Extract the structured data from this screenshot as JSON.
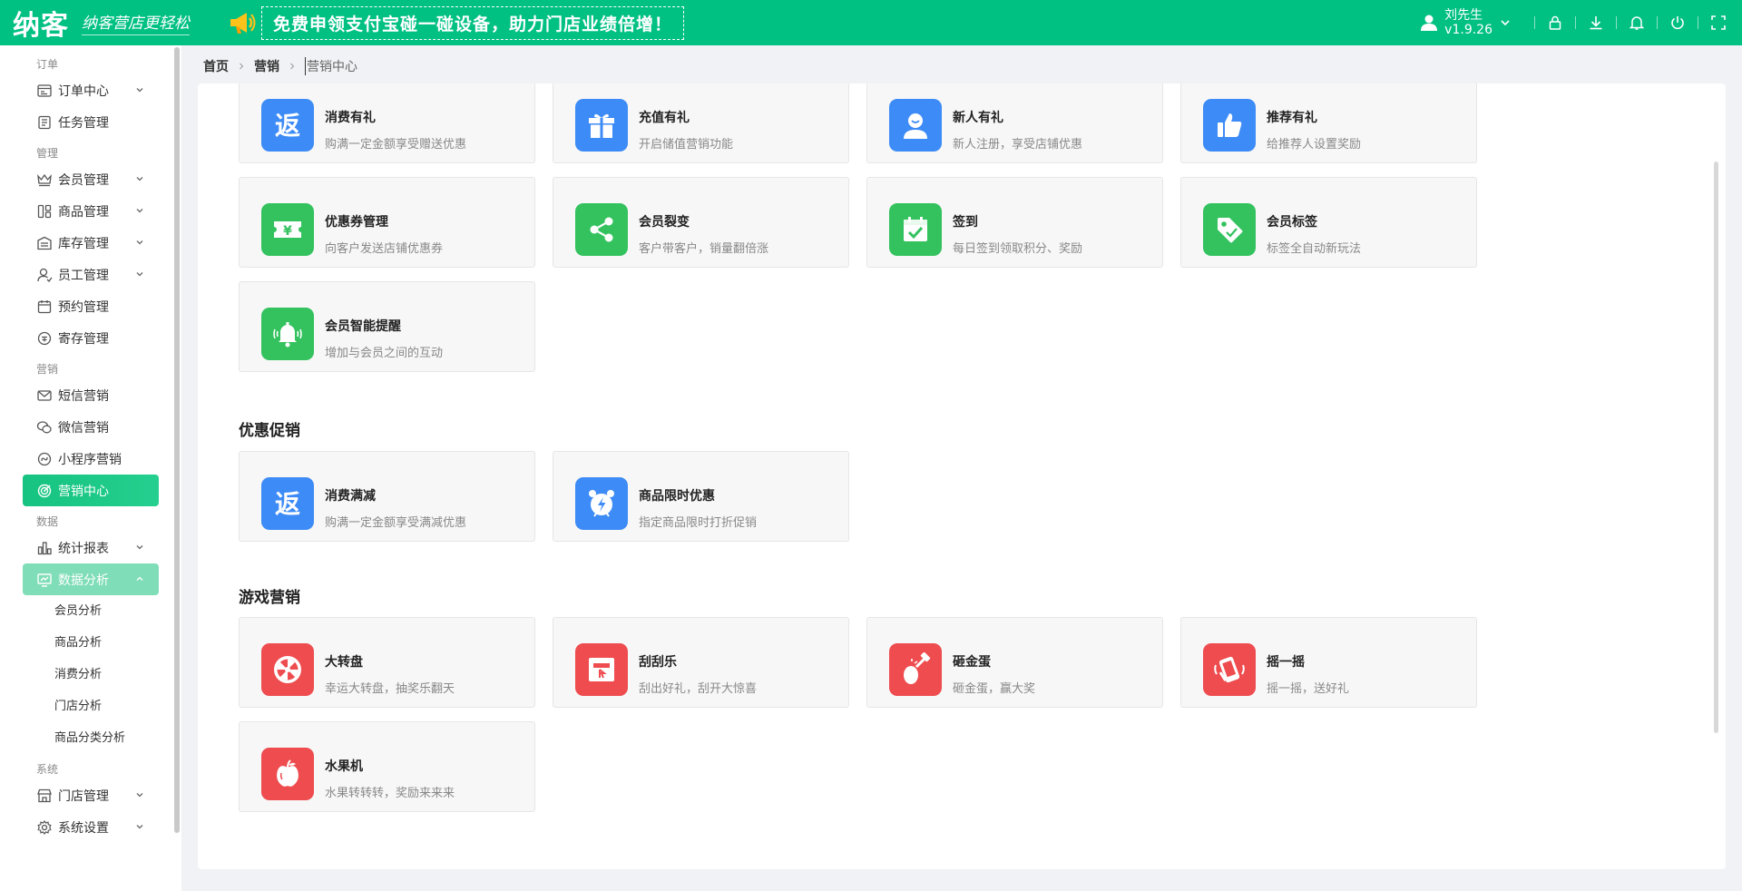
{
  "header": {
    "logo": "纳客",
    "slogan": "纳客营店更轻松",
    "promo_text": "免费申领支付宝碰一碰设备，助力门店业绩倍增！",
    "user_name": "刘先生",
    "version": "v1.9.26"
  },
  "sidebar": {
    "groups": {
      "order": "订单",
      "manage": "管理",
      "marketing": "营销",
      "data": "数据",
      "system": "系统"
    },
    "items": {
      "order_center": "订单中心",
      "task_manage": "任务管理",
      "member_manage": "会员管理",
      "goods_manage": "商品管理",
      "stock_manage": "库存管理",
      "staff_manage": "员工管理",
      "booking_manage": "预约管理",
      "deposit_manage": "寄存管理",
      "sms_marketing": "短信营销",
      "wechat_marketing": "微信营销",
      "miniapp_marketing": "小程序营销",
      "marketing_center": "营销中心",
      "stats_report": "统计报表",
      "data_analysis": "数据分析",
      "store_manage": "门店管理",
      "system_settings": "系统设置"
    },
    "sub_items": {
      "member_analysis": "会员分析",
      "goods_analysis": "商品分析",
      "consume_analysis": "消费分析",
      "store_analysis": "门店分析",
      "category_analysis": "商品分类分析"
    }
  },
  "breadcrumb": {
    "home": "首页",
    "marketing": "营销",
    "current": "营销中心"
  },
  "sections": {
    "discount": "优惠促销",
    "game": "游戏营销"
  },
  "cards": {
    "consume_gift": {
      "title": "消费有礼",
      "desc": "购满一定金额享受赠送优惠"
    },
    "recharge_gift": {
      "title": "充值有礼",
      "desc": "开启储值营销功能"
    },
    "newbie_gift": {
      "title": "新人有礼",
      "desc": "新人注册，享受店铺优惠"
    },
    "referral_gift": {
      "title": "推荐有礼",
      "desc": "给推荐人设置奖励"
    },
    "coupon_manage": {
      "title": "优惠券管理",
      "desc": "向客户发送店铺优惠券"
    },
    "member_fission": {
      "title": "会员裂变",
      "desc": "客户带客户，销量翻倍涨"
    },
    "checkin": {
      "title": "签到",
      "desc": "每日签到领取积分、奖励"
    },
    "member_tag": {
      "title": "会员标签",
      "desc": "标签全自动新玩法"
    },
    "smart_remind": {
      "title": "会员智能提醒",
      "desc": "增加与会员之间的互动"
    },
    "full_reduction": {
      "title": "消费满减",
      "desc": "购满一定金额享受满减优惠"
    },
    "flash_discount": {
      "title": "商品限时优惠",
      "desc": "指定商品限时打折促销"
    },
    "wheel": {
      "title": "大转盘",
      "desc": "幸运大转盘，抽奖乐翻天"
    },
    "scratch": {
      "title": "刮刮乐",
      "desc": "刮出好礼，刮开大惊喜"
    },
    "golden_egg": {
      "title": "砸金蛋",
      "desc": "砸金蛋，赢大奖"
    },
    "shake": {
      "title": "摇一摇",
      "desc": "摇一摇，送好礼"
    },
    "fruit_machine": {
      "title": "水果机",
      "desc": "水果转转转，奖励来来来"
    }
  },
  "colors": {
    "brand": "#00c082",
    "icon_blue": "#3d8bf6",
    "icon_green": "#33c25e",
    "icon_red": "#ee4c4f"
  }
}
